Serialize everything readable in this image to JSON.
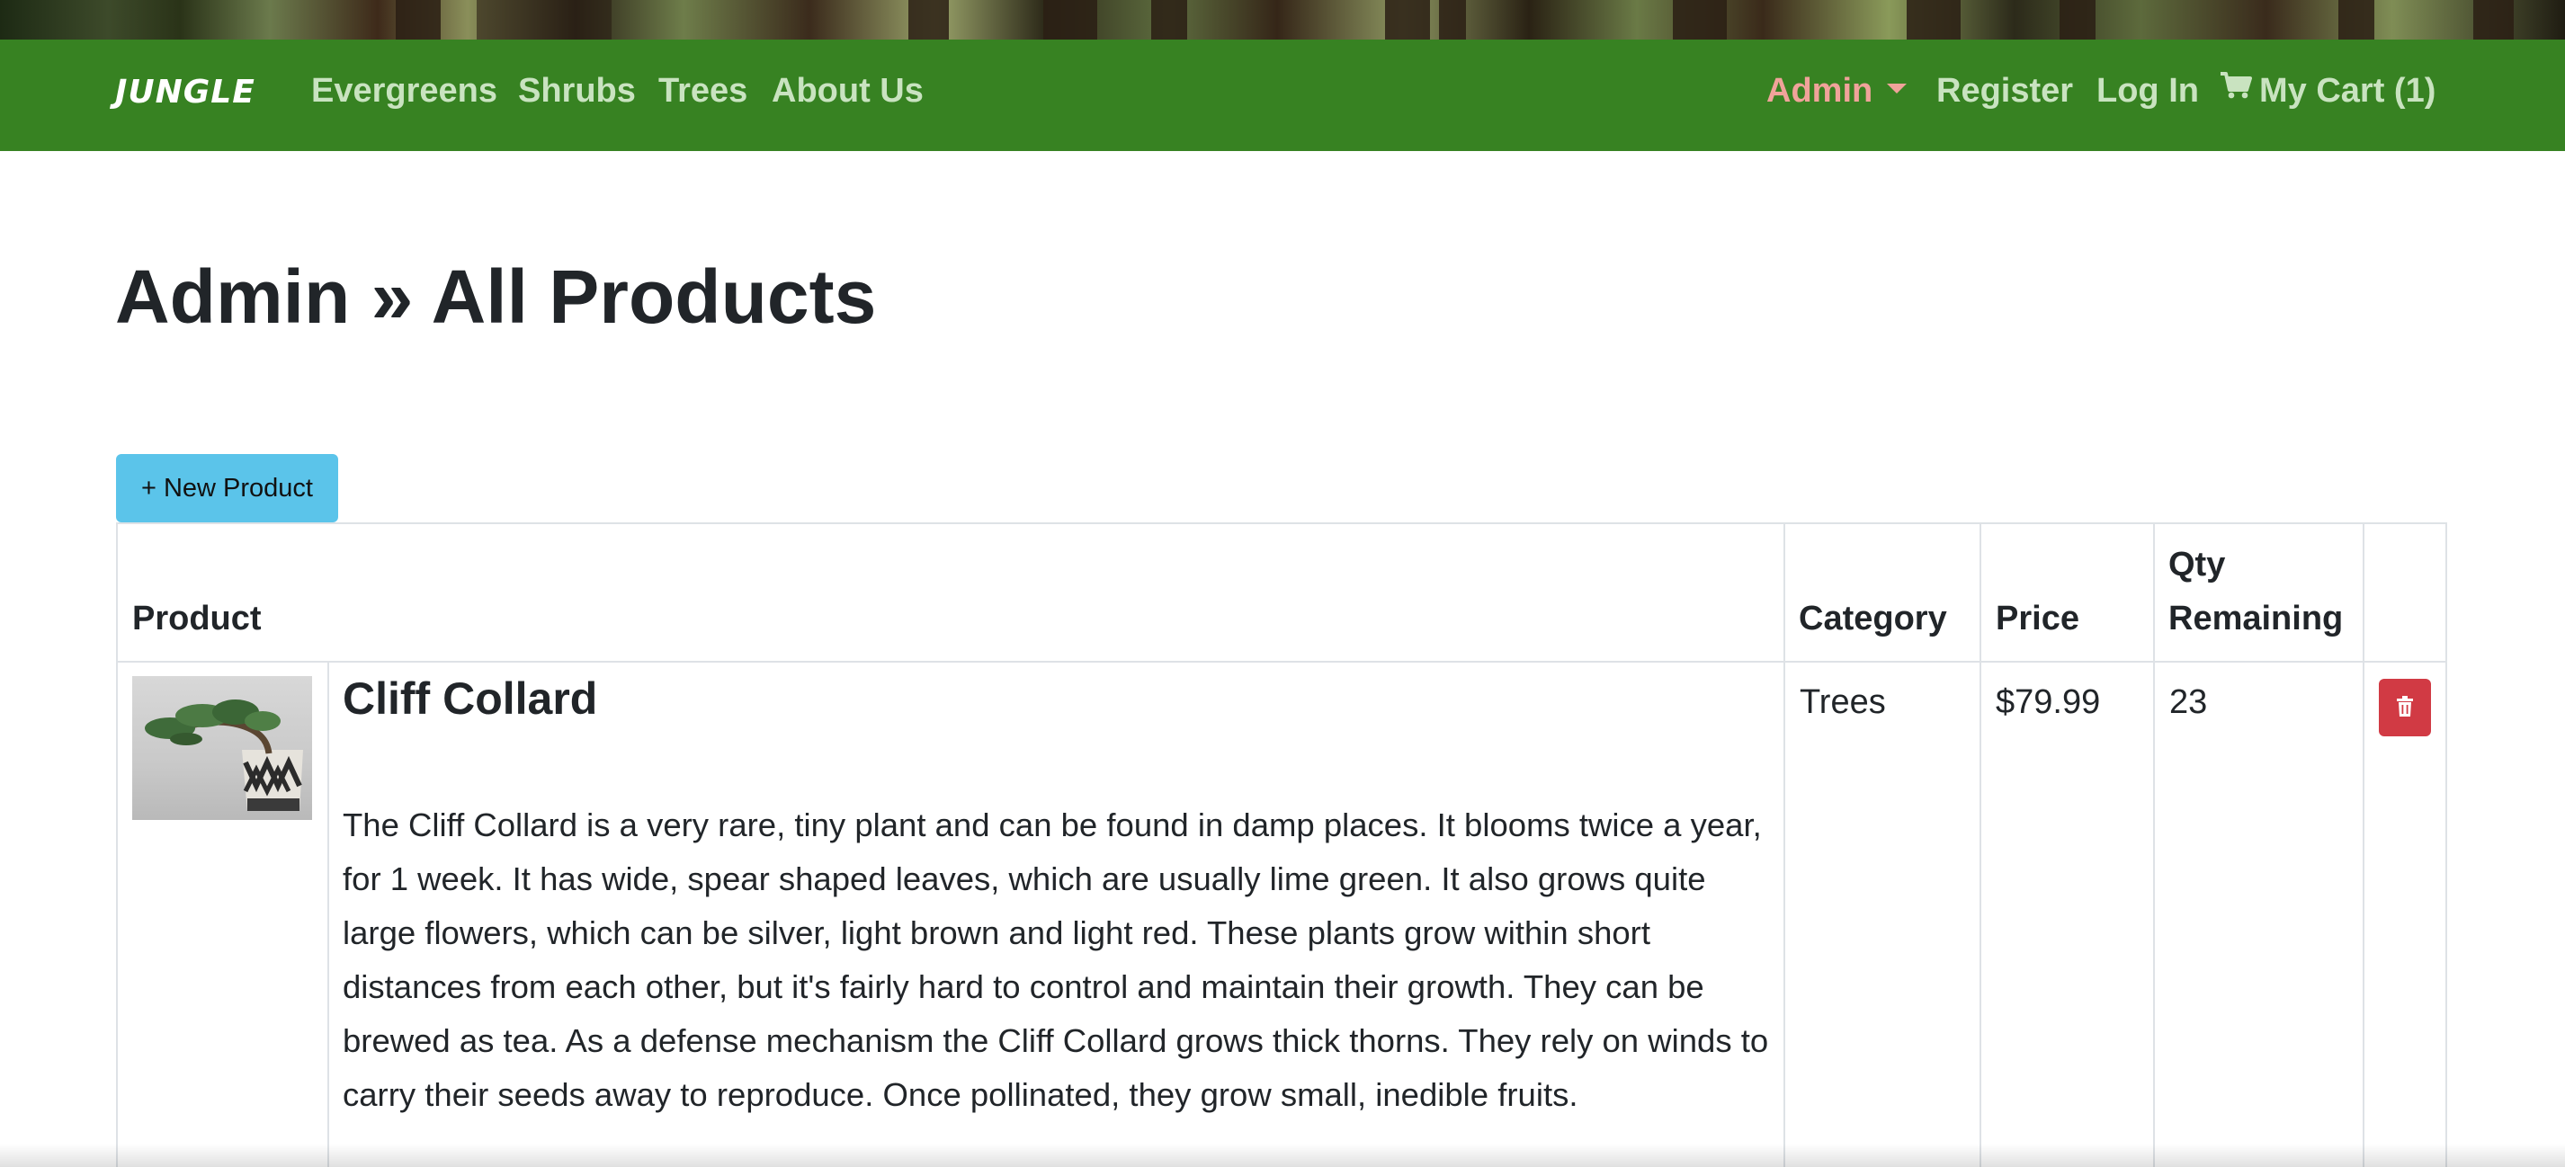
{
  "navbar": {
    "brand": "JUNGLE",
    "links": [
      {
        "label": "Evergreens"
      },
      {
        "label": "Shrubs"
      },
      {
        "label": "Trees"
      },
      {
        "label": "About Us"
      }
    ],
    "admin_label": "Admin",
    "register_label": "Register",
    "login_label": "Log In",
    "cart_label": "My Cart (1)",
    "cart_icon": "shopping-cart-icon"
  },
  "page": {
    "title": "Admin » All Products"
  },
  "actions": {
    "new_product_label": "+ New Product"
  },
  "table": {
    "headers": {
      "product": "Product",
      "category": "Category",
      "price": "Price",
      "qty_line1": "Qty",
      "qty_line2": "Remaining"
    },
    "rows": [
      {
        "name": "Cliff Collard",
        "description": "The Cliff Collard is a very rare, tiny plant and can be found in damp places. It blooms twice a year, for 1 week. It has wide, spear shaped leaves, which are usually lime green. It also grows quite large flowers, which can be silver, light brown and light red. These plants grow within short distances from each other, but it's fairly hard to control and maintain their growth. They can be brewed as tea. As a defense mechanism the Cliff Collard grows thick thorns. They rely on winds to carry their seeds away to reproduce. Once pollinated, they grow small, inedible fruits.",
        "category": "Trees",
        "price": "$79.99",
        "qty": "23",
        "image_icon": "bonsai-plant-image",
        "delete_icon": "trash-icon"
      }
    ]
  },
  "colors": {
    "navbar_bg": "#378222",
    "nav_link": "#c9e3c0",
    "admin_link": "#f0a39a",
    "new_button": "#5bc4ea",
    "delete_button": "#d13a44"
  }
}
